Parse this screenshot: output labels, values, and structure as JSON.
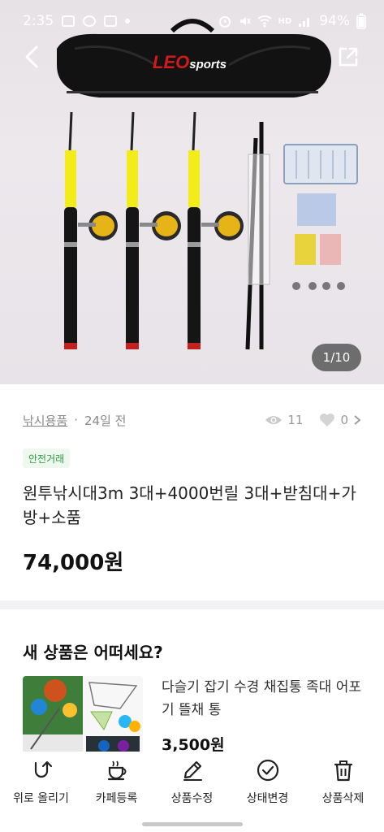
{
  "status_bar": {
    "time": "2:35",
    "network": "HD",
    "battery": "94%"
  },
  "hero": {
    "brand": "LEO",
    "brand_suffix": "sports",
    "image_counter": "1/10"
  },
  "product": {
    "category": "낚시용품",
    "posted": "24일 전",
    "views": "11",
    "likes": "0",
    "badge": "안전거래",
    "title": "원투낚시대3m 3대+4000번릴 3대+받침대+가방+소품",
    "price": "74,000원"
  },
  "recommendation": {
    "heading": "새 상품은 어떠세요?",
    "item": {
      "title": "다슬기 잡기 수경 채집통 족대 어포기 뜰채 통",
      "price": "3,500원"
    }
  },
  "bottom_nav": [
    {
      "label": "위로 올리기",
      "icon": "bump-up-icon"
    },
    {
      "label": "카페등록",
      "icon": "cafe-cup-icon"
    },
    {
      "label": "상품수정",
      "icon": "pencil-icon"
    },
    {
      "label": "상태변경",
      "icon": "check-circle-icon"
    },
    {
      "label": "상품삭제",
      "icon": "trash-icon"
    }
  ],
  "colors": {
    "safe_badge_bg": "#eef8ee",
    "safe_badge_text": "#2f9a44",
    "brand_red": "#d21a1a",
    "rod_yellow": "#f1ec1a"
  }
}
